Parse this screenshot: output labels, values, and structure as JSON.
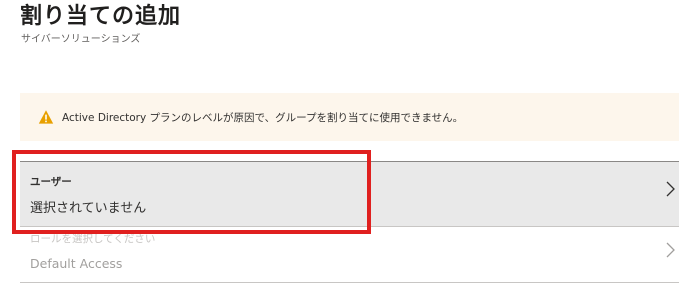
{
  "header": {
    "title": "割り当ての追加",
    "subtitle": "サイバーソリューションズ"
  },
  "warning": {
    "icon": "warning-icon",
    "text": "Active Directory プランのレベルが原因で、グループを割り当てに使用できません。",
    "color": "#e8a000"
  },
  "assignments": {
    "users": {
      "label": "ユーザー",
      "value": "選択されていません"
    },
    "role": {
      "label": "ロールを選択してください",
      "value": "Default Access"
    }
  },
  "annotation": {
    "highlight_color": "#e0201f"
  }
}
